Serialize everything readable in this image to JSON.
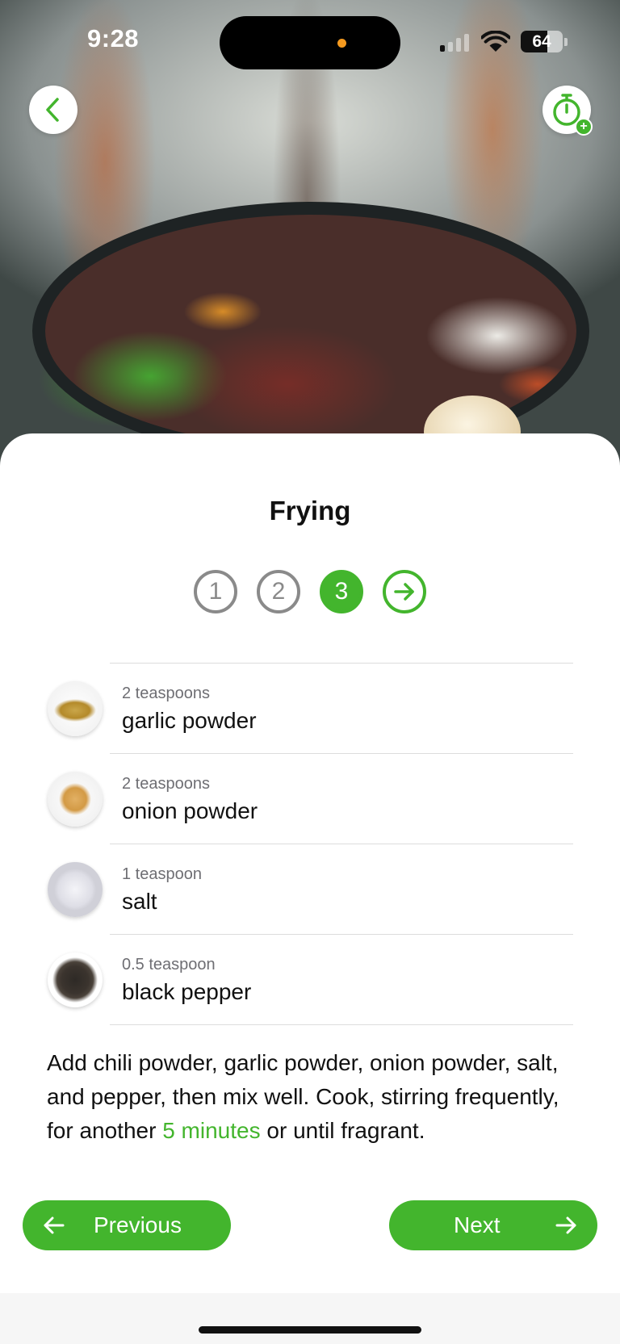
{
  "status_bar": {
    "time": "9:28",
    "battery_level": "64",
    "battery_fraction": 0.64,
    "signal_bars_active": 1,
    "signal_bars_total": 4
  },
  "hero": {
    "back_icon": "chevron-left-icon",
    "timer_icon": "stopwatch-icon",
    "timer_badge": "+"
  },
  "step": {
    "title": "Frying",
    "indicators": [
      "1",
      "2",
      "3"
    ],
    "current": 3,
    "next_icon": "arrow-right-circle-icon"
  },
  "ingredients": [
    {
      "quantity": "2 teaspoons",
      "name": "garlic powder",
      "thumb": "garlic-powder"
    },
    {
      "quantity": "2 teaspoons",
      "name": "onion powder",
      "thumb": "onion-powder"
    },
    {
      "quantity": "1 teaspoon",
      "name": "salt",
      "thumb": "salt"
    },
    {
      "quantity": "0.5 teaspoon",
      "name": "black pepper",
      "thumb": "black-pepper"
    }
  ],
  "instructions": {
    "before": "Add chili powder, garlic powder, onion powder, salt, and pepper, then mix well. Cook, stirring frequently, for another ",
    "highlight": "5 minutes",
    "after": " or until fragrant."
  },
  "nav": {
    "previous_label": "Previous",
    "next_label": "Next"
  },
  "colors": {
    "accent": "#43b52d",
    "inactive": "#8a8a8a"
  }
}
